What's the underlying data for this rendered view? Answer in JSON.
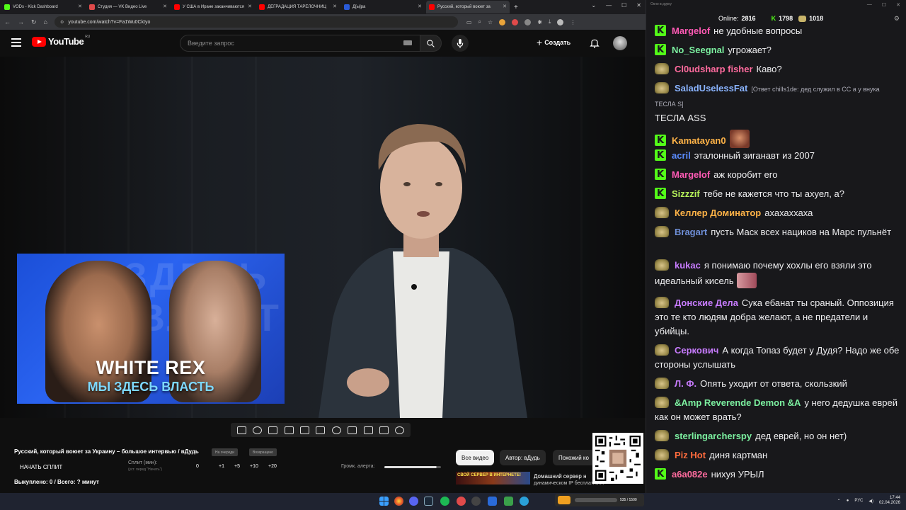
{
  "browser": {
    "tabs": [
      {
        "title": "VODs - Kick Dashboard",
        "color": "#53fc18",
        "active": false
      },
      {
        "title": "Студия — VK Видео Live",
        "color": "#e04a4a",
        "active": false
      },
      {
        "title": "У США в Иране заканчиваются",
        "color": "#ff0000",
        "active": false
      },
      {
        "title": "ДЕГРАДАЦИЯ ТАРЕЛОЧНИЦ",
        "color": "#ff0000",
        "active": false
      },
      {
        "title": "Д[ы]ра",
        "color": "#2a5bd7",
        "active": false
      },
      {
        "title": "Русский, который воюет за",
        "color": "#ff0000",
        "active": true
      }
    ],
    "url": "youtube.com/watch?v=Fa1Wu0Cktyo"
  },
  "youtube": {
    "logo_text": "YouTube",
    "logo_region": "RU",
    "search_placeholder": "Введите запрос",
    "create_label": "Создать"
  },
  "thumbnail": {
    "line1": "WHITE REX",
    "line2": "МЫ ЗДЕСЬ ВЛАСТЬ"
  },
  "bottom": {
    "video_title": "Русский, который воюет за Украину – большое интервью / вДудь",
    "pill1": "На очереди",
    "pill2": "Возвращено",
    "split_button": "НАЧАТЬ СПЛИТ",
    "split_label": "Сплит (мин):",
    "split_sub": "(уст. перед \"Начать\")",
    "split_values": [
      "0",
      "+1",
      "+5",
      "+10",
      "+20"
    ],
    "volume_label": "Громк. алерта:",
    "volume_level": 0.92,
    "bought": "Выкуплено: 0 / Всего: ? минут",
    "chips": [
      "Все видео",
      "Автор: вДудь",
      "Похожий ко"
    ],
    "ad_thumb_text": "СВОЙ СЕРВЕР В ИНТЕРНЕТЕ!",
    "ad_line1": "Домашний сервер н",
    "ad_line2": "динамическом IP бесплатно!..."
  },
  "chat": {
    "window_title": "Окно в дурку",
    "online_label": "Online:",
    "online_count": "2816",
    "kick_count": "1798",
    "other_count": "1018",
    "messages": [
      {
        "badge": "k",
        "user": "Margelof",
        "color": "#ff5ab5",
        "text": "не удобные вопросы"
      },
      {
        "badge": "k",
        "user": "No_Seegnal",
        "color": "#7cf0a0",
        "text": "угрожает?"
      },
      {
        "badge": "p",
        "user": "Cl0udsharp fisher",
        "color": "#ff6b9e",
        "text": "Каво?"
      },
      {
        "badge": "p",
        "user": "SaladUselessFat",
        "color": "#8ab4ff",
        "reply": "[Ответ chills1de: дед служил в СС а у внука ТЕСЛА  S]",
        "text": "ТЕСЛА ASS"
      },
      {
        "badge": "k",
        "user": "Kamatayan0",
        "color": "#ffb347",
        "text": ""
      },
      {
        "badge": "k",
        "user": "acril",
        "color": "#5b8cff",
        "text": "эталонный зиганавт из 2007"
      },
      {
        "badge": "k",
        "user": "Margelof",
        "color": "#ff5ab5",
        "text": "аж коробит его"
      },
      {
        "badge": "k",
        "user": "Sizzzif",
        "color": "#b6f25a",
        "text": "тебе не кажется что ты ахуел, а?"
      },
      {
        "badge": "p",
        "user": "Келлер Доминатор",
        "color": "#ffb347",
        "text": "ахахаххаха"
      },
      {
        "badge": "p",
        "user": "Bragart",
        "color": "#6f8fd8",
        "text": "пусть Маск всех нациков на Марс пульнёт"
      },
      {
        "badge": "p",
        "user": "kukac",
        "color": "#c87cff",
        "text": "я понимаю почему хохлы его взяли это идеальный кисель"
      },
      {
        "badge": "p",
        "user": "Донские Дела",
        "color": "#c87cff",
        "text": "Сука ебанат ты сраный. Оппозиция это те кто людям добра желают, а не предатели и убийцы."
      },
      {
        "badge": "p",
        "user": "Серкович",
        "color": "#c87cff",
        "text": "А когда Топаз будет у Дудя? Надо же обе стороны услышать"
      },
      {
        "badge": "p",
        "user": "Л. Ф.",
        "color": "#c87cff",
        "text": "Опять уходит от ответа, скользкий"
      },
      {
        "badge": "p",
        "user": "&Amp Reverende Demon &A",
        "color": "#7cf0a0",
        "text": "у него дедушка еврей как он может врать?"
      },
      {
        "badge": "p",
        "user": "sterlingarcherspy",
        "color": "#7cf0a0",
        "text": "дед еврей, но он нет)"
      },
      {
        "badge": "p",
        "user": "Piz Hot",
        "color": "#ff6b3d",
        "text": "диня картман"
      },
      {
        "badge": "k",
        "user": "a6a082e",
        "color": "#ff6b9e",
        "text": "нихуя УРЫЛ"
      }
    ]
  },
  "taskbar": {
    "lang": "РУС",
    "time": "17:44",
    "date": "02.04.2026",
    "promo_text": "535 / 1500"
  }
}
